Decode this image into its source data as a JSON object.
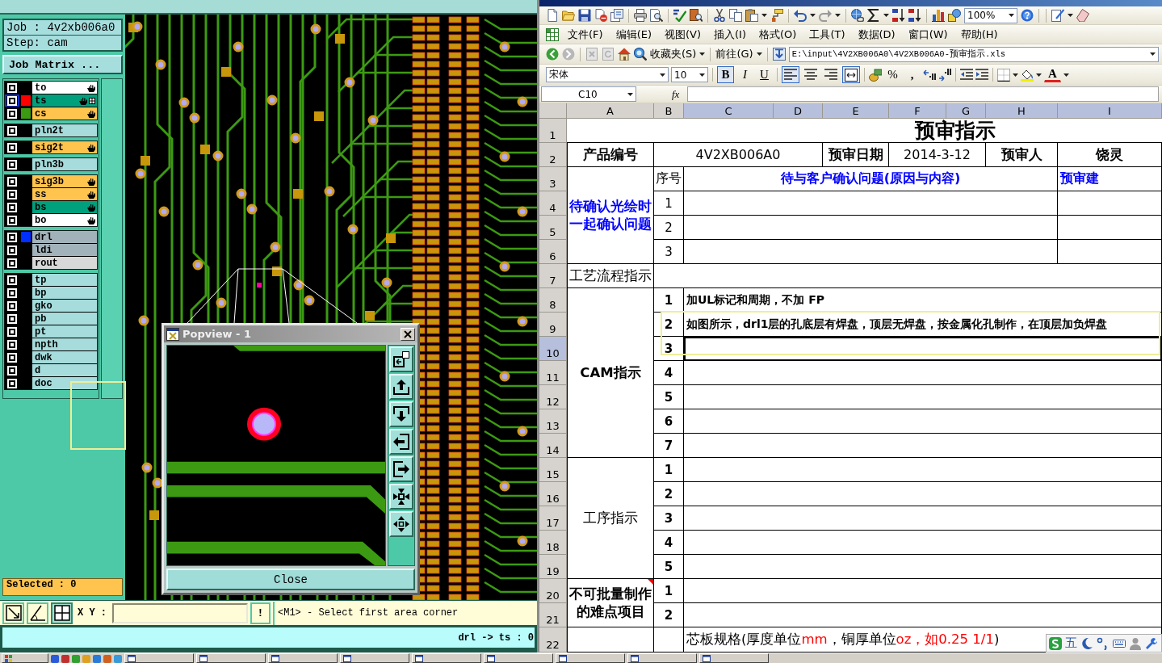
{
  "cam": {
    "job": "Job : 4v2xb006a0",
    "step": "Step: cam",
    "job_matrix_button": "Job Matrix ...",
    "layer_groups": [
      {
        "layers": [
          {
            "name": "to",
            "kind": "silk_screen",
            "selected": false,
            "hand_mark": true,
            "box_mark": false
          },
          {
            "name": "ts",
            "kind": "solder_mask",
            "color": "#ff0000",
            "selected": true,
            "hand_mark": true,
            "box_mark": true
          },
          {
            "name": "cs",
            "kind": "signal",
            "color": "#3c9a12",
            "selected": false,
            "hand_mark": true,
            "box_mark": false
          }
        ]
      },
      {
        "layers": [
          {
            "name": "pln2t",
            "kind": "power_ground",
            "selected": false,
            "hand_mark": false,
            "box_mark": false
          }
        ]
      },
      {
        "layers": [
          {
            "name": "sig2t",
            "kind": "signal",
            "selected": false,
            "hand_mark": true,
            "box_mark": false
          }
        ]
      },
      {
        "layers": [
          {
            "name": "pln3b",
            "kind": "power_ground",
            "selected": false,
            "hand_mark": false,
            "box_mark": false
          }
        ]
      },
      {
        "layers": [
          {
            "name": "sig3b",
            "kind": "signal",
            "selected": false,
            "hand_mark": true,
            "box_mark": false
          },
          {
            "name": "ss",
            "kind": "signal",
            "selected": false,
            "hand_mark": true,
            "box_mark": false
          },
          {
            "name": "bs",
            "kind": "solder_mask",
            "selected": false,
            "hand_mark": true,
            "box_mark": false
          },
          {
            "name": "bo",
            "kind": "silk_screen",
            "selected": false,
            "hand_mark": true,
            "box_mark": false
          }
        ]
      },
      {
        "layers": [
          {
            "name": "drl",
            "kind": "drill",
            "color": "#0030ff",
            "selected": false,
            "hand_mark": false,
            "box_mark": false
          },
          {
            "name": "ldi",
            "kind": "drill",
            "selected": false,
            "hand_mark": false,
            "box_mark": false
          },
          {
            "name": "rout",
            "kind": "rout",
            "selected": false,
            "hand_mark": false,
            "box_mark": false
          }
        ]
      },
      {
        "layers": [
          {
            "name": "tp",
            "kind": "document",
            "selected": false,
            "hand_mark": false,
            "box_mark": false
          },
          {
            "name": "bp",
            "kind": "document",
            "selected": false,
            "hand_mark": false,
            "box_mark": false
          },
          {
            "name": "gko",
            "kind": "document",
            "selected": false,
            "hand_mark": false,
            "box_mark": false
          },
          {
            "name": "pb",
            "kind": "document",
            "selected": false,
            "hand_mark": false,
            "box_mark": false
          },
          {
            "name": "pt",
            "kind": "document",
            "selected": false,
            "hand_mark": false,
            "box_mark": false
          },
          {
            "name": "npth",
            "kind": "document",
            "selected": false,
            "hand_mark": false,
            "box_mark": false
          },
          {
            "name": "dwk",
            "kind": "document",
            "selected": false,
            "hand_mark": false,
            "box_mark": false
          },
          {
            "name": "d",
            "kind": "document",
            "selected": false,
            "hand_mark": false,
            "box_mark": false
          },
          {
            "name": "doc",
            "kind": "document",
            "selected": false,
            "hand_mark": false,
            "box_mark": false
          }
        ]
      }
    ],
    "selected_count": "Selected : 0",
    "bottom_tools": [
      {
        "selected": false
      },
      {
        "selected": false
      },
      {
        "selected": true
      }
    ],
    "coordinate_label": "X Y :",
    "alert_button": "!",
    "prompt": "<M1> - Select first area corner",
    "status": "drl -> ts : 0",
    "popview": {
      "title": "Popview - 1",
      "close_button": "Close"
    }
  },
  "excel": {
    "zoom": "100%",
    "menu": [
      "文件(F)",
      "编辑(E)",
      "视图(V)",
      "插入(I)",
      "格式(O)",
      "工具(T)",
      "数据(D)",
      "窗口(W)",
      "帮助(H)"
    ],
    "favorites_button": "收藏夹(S)",
    "go_button": "前往(G)",
    "address": "E:\\input\\4V2XB006A0\\4V2XB006A0-预审指示.xls",
    "font": "宋体",
    "font_size": "10",
    "style_buttons": [
      {
        "label": "B",
        "selected": true
      },
      {
        "label": "I",
        "selected": false
      },
      {
        "label": "U",
        "selected": false
      }
    ],
    "align_buttons": [
      {
        "selected": true
      },
      {
        "selected": false
      },
      {
        "selected": false
      },
      {
        "selected": true
      }
    ],
    "percent": "%",
    "comma": ",",
    "font_color": "A",
    "name_box": "C10",
    "formula_label": "fx",
    "columns": [
      {
        "label": "A",
        "selected": false
      },
      {
        "label": "B",
        "selected": false
      },
      {
        "label": "C",
        "selected": true
      },
      {
        "label": "D",
        "selected": true
      },
      {
        "label": "E",
        "selected": true
      },
      {
        "label": "F",
        "selected": true
      },
      {
        "label": "G",
        "selected": true
      },
      {
        "label": "H",
        "selected": true
      },
      {
        "label": "I",
        "selected": true
      }
    ],
    "rows": [
      {
        "label": "1",
        "selected": false
      },
      {
        "label": "2",
        "selected": false
      },
      {
        "label": "3",
        "selected": false
      },
      {
        "label": "4",
        "selected": false
      },
      {
        "label": "5",
        "selected": false
      },
      {
        "label": "6",
        "selected": false
      },
      {
        "label": "7",
        "selected": false
      },
      {
        "label": "8",
        "selected": false
      },
      {
        "label": "9",
        "selected": false
      },
      {
        "label": "10",
        "selected": true
      },
      {
        "label": "11",
        "selected": false
      },
      {
        "label": "12",
        "selected": false
      },
      {
        "label": "13",
        "selected": false
      },
      {
        "label": "14",
        "selected": false
      },
      {
        "label": "15",
        "selected": false
      },
      {
        "label": "16",
        "selected": false
      },
      {
        "label": "17",
        "selected": false
      },
      {
        "label": "18",
        "selected": false
      },
      {
        "label": "19",
        "selected": false
      },
      {
        "label": "20",
        "selected": false
      },
      {
        "label": "21",
        "selected": false
      },
      {
        "label": "22",
        "selected": false
      }
    ],
    "sheet": {
      "title": "预审指示",
      "product_label": "产品编号",
      "product_no": "4V2XB006A0",
      "date_label": "预审日期",
      "date": "2014-3-12",
      "reviewer_label": "预审人",
      "reviewer": "饶灵",
      "sections": [
        {
          "kind": "confirm",
          "label": "待确认光绘时一起确认问题",
          "label_bold": true,
          "comment": false,
          "no_header": "序号",
          "question_header": "待与客户确认问题(原因与内容)",
          "advice_header": "预审建",
          "items": [
            {
              "no": "1"
            },
            {
              "no": "2"
            },
            {
              "no": "3"
            }
          ]
        },
        {
          "kind": "single",
          "label": "工艺流程指示",
          "label_bold": false,
          "comment": false
        },
        {
          "kind": "list",
          "label": "CAM指示",
          "label_bold": true,
          "comment": false,
          "items": [
            {
              "no": "1",
              "text": "加UL标记和周期，不加 FP",
              "selected": false
            },
            {
              "no": "2",
              "text": "如图所示，drl1层的孔底层有焊盘，顶层无焊盘，按金属化孔制作，在顶层加负焊盘",
              "selected": false
            },
            {
              "no": "3",
              "selected": true
            },
            {
              "no": "4",
              "selected": false
            },
            {
              "no": "5",
              "selected": false
            },
            {
              "no": "6",
              "selected": false
            },
            {
              "no": "7",
              "selected": false
            }
          ]
        },
        {
          "kind": "list",
          "label": "工序指示",
          "label_bold": false,
          "comment": false,
          "items": [
            {
              "no": "1",
              "selected": false
            },
            {
              "no": "2",
              "selected": false
            },
            {
              "no": "3",
              "selected": false
            },
            {
              "no": "4",
              "selected": false
            },
            {
              "no": "5",
              "selected": false
            }
          ]
        },
        {
          "kind": "list",
          "label": "不可批量制作的难点项目",
          "label_bold": true,
          "comment": true,
          "items": [
            {
              "no": "1",
              "selected": false
            },
            {
              "no": "2",
              "selected": false
            }
          ]
        },
        {
          "kind": "spec",
          "comment": false,
          "segments": [
            {
              "text": "芯板规格(厚度单位",
              "color": "#000000"
            },
            {
              "text": "mm",
              "color": "#ff0000"
            },
            {
              "text": "，铜厚单位",
              "color": "#000000"
            },
            {
              "text": "oz，如0.25 1/1",
              "color": "#ff0000"
            },
            {
              "text": ")",
              "color": "#000000"
            }
          ]
        }
      ]
    }
  },
  "ime": {
    "mode": "五"
  }
}
